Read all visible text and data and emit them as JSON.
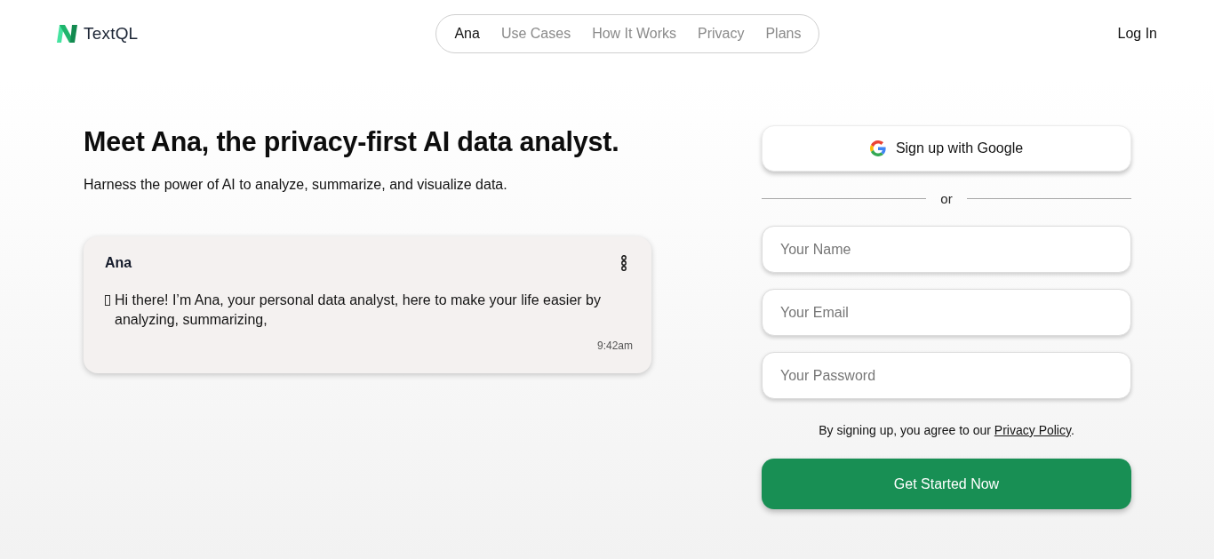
{
  "header": {
    "logo": {
      "text": "TextQL"
    },
    "nav": [
      {
        "label": "Ana",
        "selected": true
      },
      {
        "label": "Use Cases",
        "selected": false
      },
      {
        "label": "How It Works",
        "selected": false
      },
      {
        "label": "Privacy",
        "selected": false
      },
      {
        "label": "Plans",
        "selected": false
      }
    ],
    "login": "Log In"
  },
  "hero": {
    "title": "Meet Ana, the privacy-first AI data analyst.",
    "subtitle": "Harness the power of AI to analyze, summarize, and visualize data.",
    "chat_card": {
      "sender": "Ana",
      "message": "Hi there! I’m Ana, your personal data analyst, here to make your life easier by analyzing, summarizing,",
      "time": "9:42am"
    }
  },
  "signup": {
    "google_button": "Sign up with Google",
    "divider": "or",
    "fields": [
      {
        "placeholder": "Your Name"
      },
      {
        "placeholder": "Your Email"
      },
      {
        "placeholder": "Your Password"
      }
    ],
    "terms": {
      "text": "By signing up, you agree to our ",
      "link": "Privacy Policy",
      "end": "."
    },
    "submit": "Get Started Now"
  }
}
